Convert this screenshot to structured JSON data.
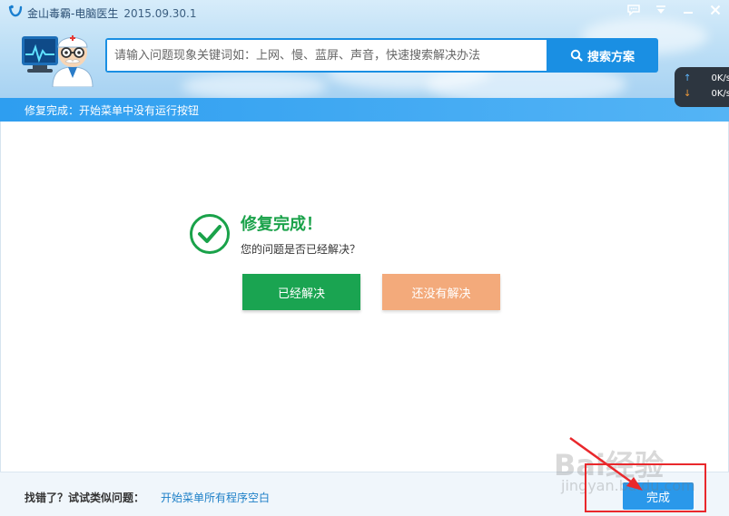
{
  "window": {
    "title": "金山毒霸-电脑医生",
    "version": "2015.09.30.1"
  },
  "search": {
    "placeholder": "请输入问题现象关键词如：上网、慢、蓝屏、声音，快速搜索解决办法",
    "button_label": "搜索方案"
  },
  "speed": {
    "upload": "0K/s",
    "download": "0K/s"
  },
  "status": {
    "text": "修复完成：开始菜单中没有运行按钮"
  },
  "result": {
    "title": "修复完成！",
    "question": "您的问题是否已经解决？",
    "solved_label": "已经解决",
    "unsolved_label": "还没有解决"
  },
  "footer": {
    "label": "找错了？试试类似问题：",
    "link": "开始菜单所有程序空白",
    "done_label": "完成"
  },
  "watermark": {
    "text": "Bai经验",
    "sub": "jingyan.baidu.com"
  },
  "colors": {
    "accent": "#1a8fe3",
    "success": "#1aa451",
    "warning_soft": "#f3aa7b",
    "status_bar": "#2e9ef0",
    "annotation": "#e9282c"
  },
  "icons": {
    "logo": "kingsoft-logo-icon",
    "chat": "chat-icon",
    "menu": "menu-icon",
    "minimize": "minimize-icon",
    "close": "close-icon",
    "search": "search-icon",
    "check": "check-circle-icon",
    "mascot": "doctor-mascot-icon"
  }
}
